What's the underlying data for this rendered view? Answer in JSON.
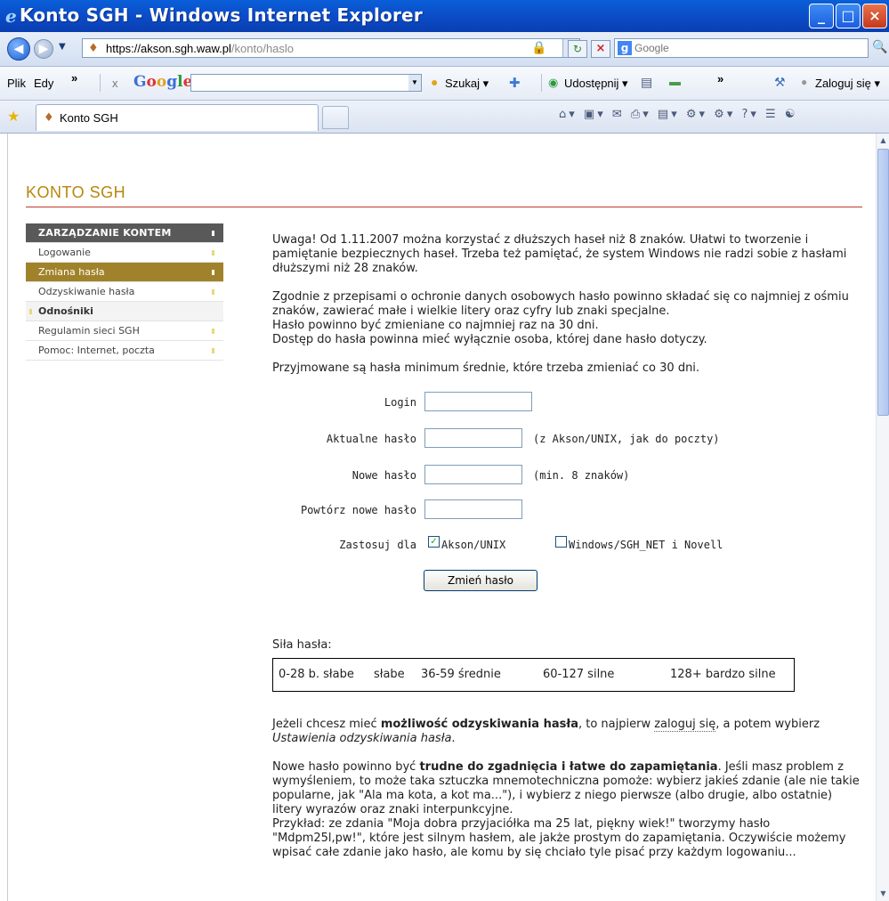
{
  "window": {
    "title": "Konto SGH - Windows Internet Explorer",
    "logo_glyph": "e",
    "min_glyph": "_",
    "max_glyph": "□",
    "close_glyph": "×"
  },
  "address": {
    "url_host": "https://akson.sgh.waw.pl",
    "url_path": "/konto/haslo",
    "search_placeholder": "Google"
  },
  "menu": {
    "file": "Plik",
    "edit": "Edy",
    "more": "»",
    "close_x": "x",
    "google_logo": "Google",
    "search_btn": "Szukaj ▾",
    "share_btn": "Udostępnij ▾",
    "more2": "»",
    "login_btn": "Zaloguj się ▾"
  },
  "tabs": {
    "active_label": "Konto SGH"
  },
  "page": {
    "site_title": "KONTO SGH",
    "sidebar": [
      {
        "label": "ZARZĄDZANIE KONTEM",
        "kind": "header"
      },
      {
        "label": "Logowanie",
        "kind": "link"
      },
      {
        "label": "Zmiana hasła",
        "kind": "active"
      },
      {
        "label": "Odzyskiwanie hasła",
        "kind": "link"
      },
      {
        "label": "Odnośniki",
        "kind": "section"
      },
      {
        "label": "Regulamin sieci SGH",
        "kind": "link"
      },
      {
        "label": "Pomoc: Internet, poczta",
        "kind": "link"
      }
    ],
    "intro": {
      "p1": "Uwaga! Od 1.11.2007 można korzystać z dłuższych haseł niż 8 znaków. Ułatwi to tworzenie i pamiętanie bezpiecznych haseł. Trzeba też pamiętać, że system Windows nie radzi sobie z hasłami dłuższymi niż 28 znaków.",
      "p2a": "Zgodnie z przepisami o ochronie danych osobowych hasło powinno składać się co najmniej z ośmiu znaków, zawierać małe i wielkie litery oraz cyfry lub znaki specjalne.",
      "p2b": "Hasło powinno być zmieniane co najmniej raz na 30 dni.",
      "p2c": "Dostęp do hasła powinna mieć wyłącznie osoba, której dane hasło dotyczy.",
      "p3": "Przyjmowane są hasła minimum średnie, które trzeba zmieniać co 30 dni."
    },
    "form": {
      "login_label": "Login",
      "current_label": "Aktualne hasło",
      "current_hint": "(z Akson/UNIX, jak do poczty)",
      "new_label": "Nowe hasło",
      "new_hint": "(min. 8 znaków)",
      "repeat_label": "Powtórz nowe hasło",
      "apply_label": "Zastosuj dla",
      "opt_akson": "Akson/UNIX",
      "opt_akson_checked": true,
      "opt_windows": "Windows/SGH_NET i Novell",
      "opt_windows_checked": false,
      "submit": "Zmień hasło",
      "checkmark": "✓"
    },
    "strength": {
      "label": "Siła hasła:",
      "levels": [
        "0-28 b. słabe",
        "słabe",
        "36-59 średnie",
        "60-127 silne",
        "128+ bardzo silne"
      ]
    },
    "recovery": {
      "t1": "Jeżeli chcesz mieć ",
      "t1b": "możliwość odzyskiwania hasła",
      "t2": ", to najpierw ",
      "link": "zaloguj się",
      "t3": ", a potem wybierz ",
      "t3i": "Ustawienia odzyskiwania hasła",
      "t4": "."
    },
    "tips": {
      "t1": "Nowe hasło powinno być ",
      "t1b": "trudne do zgadnięcia i łatwe do zapamiętania",
      "t2": ". Jeśli masz problem z wymyśleniem, to może taka sztuczka mnemotechniczna pomoże: wybierz jakieś zdanie (ale nie takie popularne, jak \"Ala ma kota, a kot ma...\"), i wybierz z niego pierwsze (albo drugie, albo ostatnie) litery wyrazów oraz znaki interpunkcyjne.",
      "t3": "Przykład: ze zdania \"Moja dobra przyjaciółka ma 25 lat, piękny wiek!\" tworzymy hasło \"Mdpm25l,pw!\", które jest silnym hasłem, ale jakże prostym do zapamiętania. Oczywiście możemy wpisać całe zdanie jako hasło, ale komu by się chciało tyle pisać przy każdym logowaniu..."
    }
  }
}
